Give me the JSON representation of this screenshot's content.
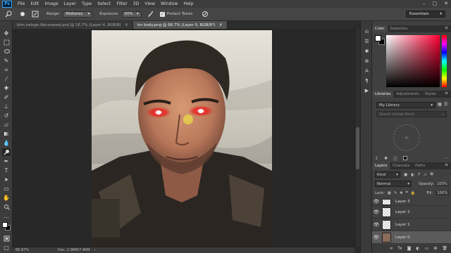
{
  "menubar": {
    "logo": "Ps",
    "items": [
      "File",
      "Edit",
      "Image",
      "Layer",
      "Type",
      "Select",
      "Filter",
      "3D",
      "View",
      "Window",
      "Help"
    ]
  },
  "options": {
    "range_label": "Range:",
    "range_value": "Midtones",
    "exposure_label": "Exposure:",
    "exposure_value": "50%",
    "protect_tones_label": "Protect Tones",
    "protect_tones_checked": true,
    "workspace": "Essentials"
  },
  "tabs": [
    {
      "label": "btm mdsgn-Recovered.psd @ 16.7% (Layer 4, RGB/8)",
      "active": false
    },
    {
      "label": "tm body.png @ 66.7% (Layer 0, RGB/8*)",
      "active": true
    }
  ],
  "status": {
    "zoom": "66.67%",
    "doc": "Doc: 2.96M/7.46M"
  },
  "panels": {
    "color_tabs": [
      "Color",
      "Swatches"
    ],
    "library_tabs": [
      "Libraries",
      "Adjustments",
      "Styles"
    ],
    "library_select": "My Library",
    "library_search_placeholder": "Search Adobe Stock",
    "layers_tabs": [
      "Layers",
      "Channels",
      "Paths"
    ],
    "filter_kind": "Kind",
    "blend_mode": "Normal",
    "opacity_label": "Opacity:",
    "opacity_value": "100%",
    "lock_label": "Lock:",
    "fill_label": "Fill:",
    "fill_value": "100%",
    "layers": [
      {
        "name": "Layer 3",
        "selected": false,
        "is_photo": false
      },
      {
        "name": "Layer 2",
        "selected": false,
        "is_photo": false
      },
      {
        "name": "Layer 1",
        "selected": false,
        "is_photo": false
      },
      {
        "name": "Layer 0",
        "selected": true,
        "is_photo": true
      }
    ]
  },
  "colors": {
    "accent": "#31a8ff",
    "panel_bg": "#404040",
    "eye_glow": "#ff2a2a"
  }
}
